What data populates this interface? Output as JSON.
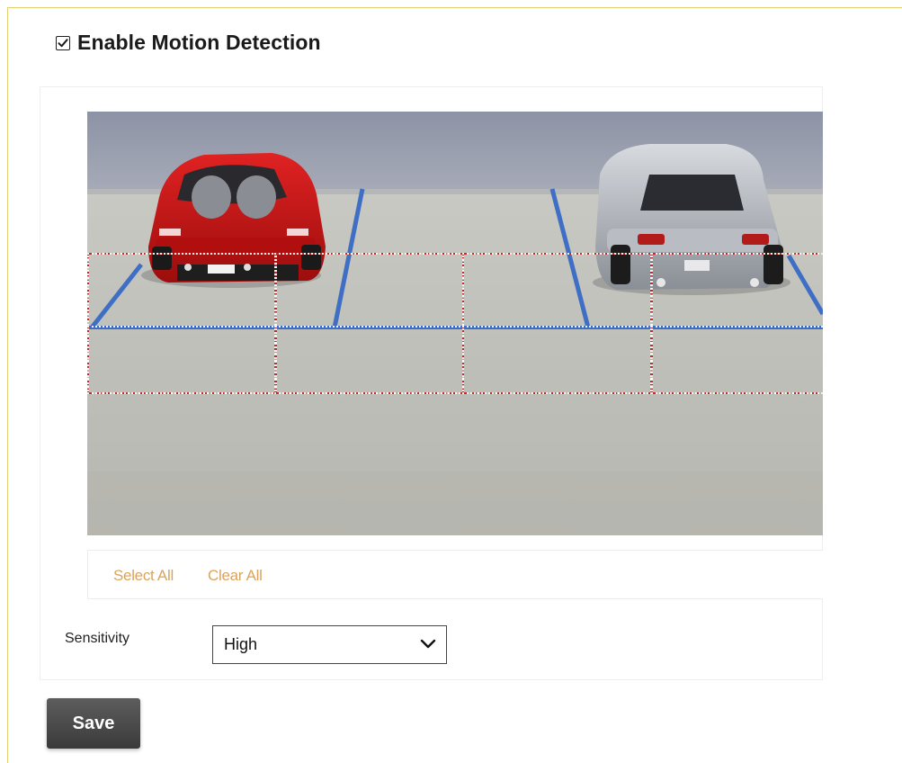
{
  "motion_detection": {
    "enable_label": "Enable Motion Detection",
    "enabled": true
  },
  "camera": {
    "scene_description": "parking-lot-model-with-red-and-silver-cars",
    "grid": {
      "rows": 2,
      "columns": 4,
      "selected": [
        [
          true,
          true,
          true,
          true
        ],
        [
          true,
          true,
          true,
          true
        ]
      ],
      "line_color": "#c62828"
    }
  },
  "actions": {
    "select_all_label": "Select All",
    "clear_all_label": "Clear All",
    "link_color": "#d9a45c"
  },
  "sensitivity": {
    "label": "Sensitivity",
    "selected": "High"
  },
  "save_label": "Save"
}
